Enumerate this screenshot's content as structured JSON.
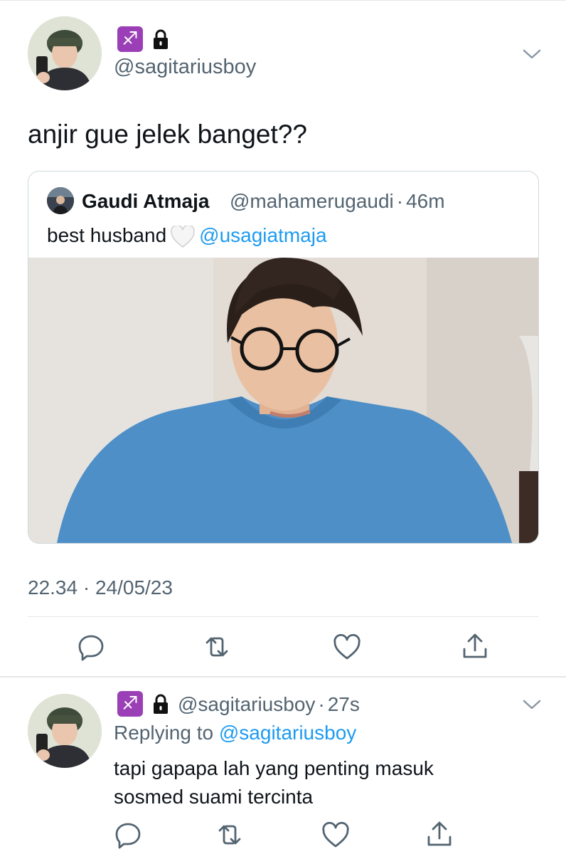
{
  "main_tweet": {
    "handle": "@sagitariusboy",
    "zodiac_badge": "♐",
    "lock_icon": "lock-icon",
    "text": "anjir gue jelek banget??",
    "timestamp": "22.34 · 24/05/23"
  },
  "quoted_tweet": {
    "name": "Gaudi Atmaja",
    "handle": "@mahamerugaudi",
    "separator": "·",
    "time": "46m",
    "text": "best husband",
    "mention": "@usagiatmaja"
  },
  "reply_tweet": {
    "zodiac_badge": "♐",
    "handle": "@sagitariusboy",
    "separator": "·",
    "time": "27s",
    "replying_label": "Replying to",
    "replying_to": "@sagitariusboy",
    "text_line1": "tapi gapapa lah yang penting masuk",
    "text_line2": "sosmed suami tercinta"
  },
  "actions": [
    "reply-icon",
    "retweet-icon",
    "like-icon",
    "share-icon"
  ],
  "colors": {
    "link": "#1d9bf0",
    "secondary_text": "#536471",
    "zodiac_badge": "#9b3fb7",
    "icon": "#536471"
  }
}
